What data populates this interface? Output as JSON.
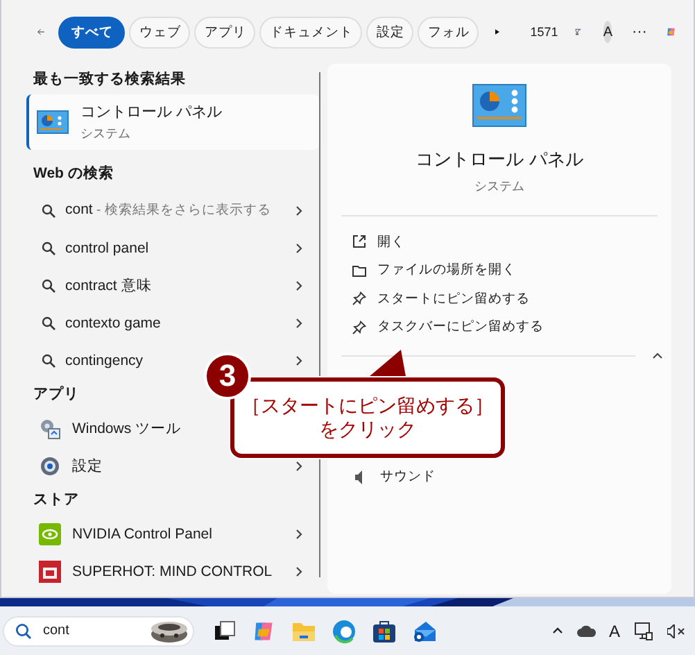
{
  "top_bar": {
    "filters": [
      {
        "label": "すべて",
        "selected": true
      },
      {
        "label": "ウェブ",
        "selected": false
      },
      {
        "label": "アプリ",
        "selected": false
      },
      {
        "label": "ドキュメント",
        "selected": false
      },
      {
        "label": "設定",
        "selected": false
      },
      {
        "label": "フォル",
        "selected": false
      }
    ],
    "points": "1571",
    "avatar": "A",
    "more": "···"
  },
  "results": {
    "best_heading": "最も一致する検索結果",
    "best": {
      "title": "コントロール パネル",
      "subtitle": "システム",
      "selected": true
    },
    "web_heading": "Web の検索",
    "web_items": [
      {
        "query": "cont",
        "hint": " - 検索結果をさらに表示する"
      },
      {
        "query": "control panel"
      },
      {
        "query": "contract 意味"
      },
      {
        "query": "contexto game"
      },
      {
        "query": "contingency"
      }
    ],
    "apps_heading": "アプリ",
    "apps": [
      {
        "kind": "tools",
        "label": "Windows ツール"
      },
      {
        "kind": "settings",
        "label": "設定"
      }
    ],
    "store_heading": "ストア",
    "store": [
      {
        "kind": "nvidia",
        "label": "NVIDIA Control Panel"
      },
      {
        "kind": "game",
        "label": "SUPERHOT: MIND CONTROL"
      }
    ]
  },
  "detail": {
    "title": "コントロール パネル",
    "subtitle": "システム",
    "actions": [
      {
        "kind": "open",
        "label": "開く"
      },
      {
        "kind": "folder",
        "label": "ファイルの場所を開く"
      },
      {
        "kind": "pin",
        "label": "スタートにピン留めする"
      },
      {
        "kind": "pin",
        "label": "タスクバーにピン留めする"
      }
    ],
    "related": [
      {
        "label": "サウンド"
      }
    ]
  },
  "callout": {
    "number": "3",
    "lines": [
      "［スタートにピン留めする］",
      "をクリック"
    ]
  },
  "taskbar": {
    "search": {
      "value": "cont"
    },
    "tray_ime": "A"
  }
}
